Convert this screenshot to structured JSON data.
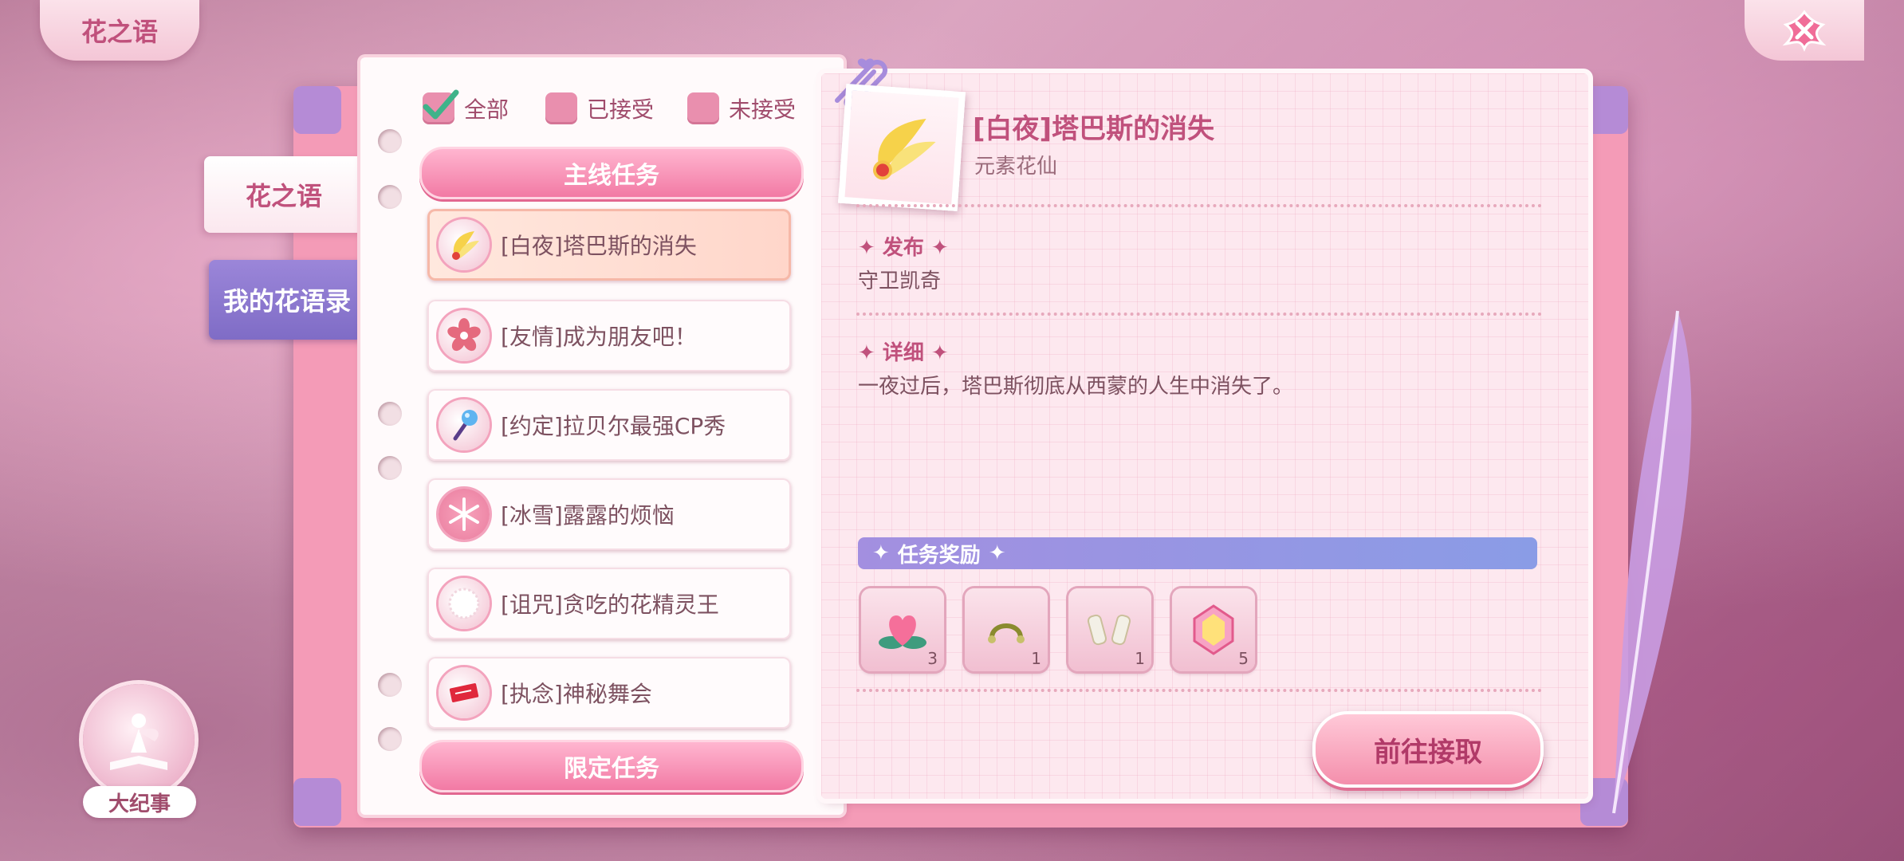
{
  "header": {
    "title": "花之语"
  },
  "side_tabs": [
    "花之语",
    "我的花语录"
  ],
  "filters": [
    {
      "label": "全部",
      "checked": true
    },
    {
      "label": "已接受",
      "checked": false
    },
    {
      "label": "未接受",
      "checked": false
    }
  ],
  "sections": {
    "main": "主线任务",
    "limited": "限定任务"
  },
  "quests": [
    {
      "label": "[白夜]塔巴斯的消失",
      "icon": "feather-brooch-icon",
      "active": true
    },
    {
      "label": "[友情]成为朋友吧！",
      "icon": "flower-icon",
      "active": false
    },
    {
      "label": "[约定]拉贝尔最强CP秀",
      "icon": "microphone-icon",
      "active": false
    },
    {
      "label": "[冰雪]露露的烦恼",
      "icon": "snowflake-icon",
      "active": false
    },
    {
      "label": "[诅咒]贪吃的花精灵王",
      "icon": "fluff-ball-icon",
      "active": false
    },
    {
      "label": "[执念]神秘舞会",
      "icon": "ticket-icon",
      "active": false
    }
  ],
  "detail": {
    "title": "[白夜]塔巴斯的消失",
    "subtitle": "元素花仙",
    "publisher_label": "发布",
    "publisher": "守卫凯奇",
    "detail_label": "详细",
    "description": "一夜过后，塔巴斯彻底从西蒙的人生中消失了。",
    "rewards_label": "任务奖励",
    "rewards": [
      {
        "icon": "heart-flower-icon",
        "count": "3"
      },
      {
        "icon": "hair-band-icon",
        "count": "1"
      },
      {
        "icon": "gloves-icon",
        "count": "1"
      },
      {
        "icon": "crystal-icon",
        "count": "5"
      }
    ],
    "go_button": "前往接取"
  },
  "timeline": {
    "label": "大纪事"
  },
  "colors": {
    "accent": "#c0517c",
    "tab_purple": "#8a74cc",
    "button_pink": "#f48fac"
  }
}
